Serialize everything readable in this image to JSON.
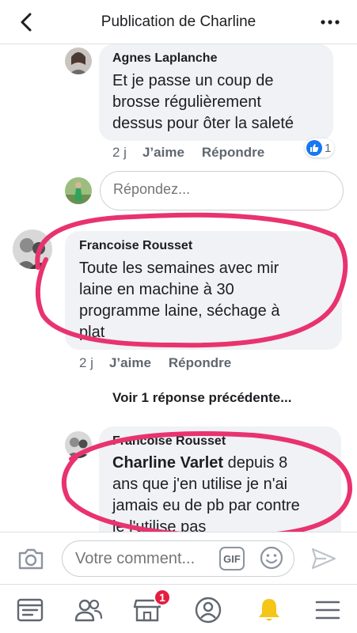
{
  "header": {
    "title": "Publication de Charline",
    "back_icon": "chevron-left-icon",
    "more_icon": "more-horizontal-icon"
  },
  "comments": [
    {
      "author": "Agnes Laplanche",
      "text_lines": [
        "Et je passe un coup de",
        "brosse régulièrement",
        "dessus pour ôter la saleté"
      ],
      "time": "2 j",
      "like_label": "J’aime",
      "reply_label": "Répondre",
      "reaction_count": "1"
    },
    {
      "author": "Francoise Rousset",
      "text_lines": [
        "Toute les semaines avec mir",
        "laine en machine à 30",
        "programme laine, séchage à",
        "plat"
      ],
      "time": "2 j",
      "like_label": "J’aime",
      "reply_label": "Répondre"
    },
    {
      "author": "Francoise Rousset",
      "mention": "Charline Varlet",
      "text_lines": [
        " depuis 8",
        "ans que j'en utilise je n'ai",
        "jamais eu de pb par contre",
        "je l'utilise pas"
      ]
    }
  ],
  "reply_box": {
    "placeholder": "Répondez..."
  },
  "view_previous": "Voir 1 réponse précédente...",
  "composer": {
    "placeholder": "Votre comment...",
    "gif_label": "GIF"
  },
  "nav": {
    "items": [
      "news-feed-icon",
      "friends-icon",
      "marketplace-icon",
      "profile-icon",
      "notifications-icon",
      "menu-icon"
    ],
    "marketplace_badge": "1"
  },
  "colors": {
    "accent": "#1877f2",
    "annotation": "#e8336f",
    "badge": "#e41e3f",
    "notification_bell": "#f5c518"
  }
}
